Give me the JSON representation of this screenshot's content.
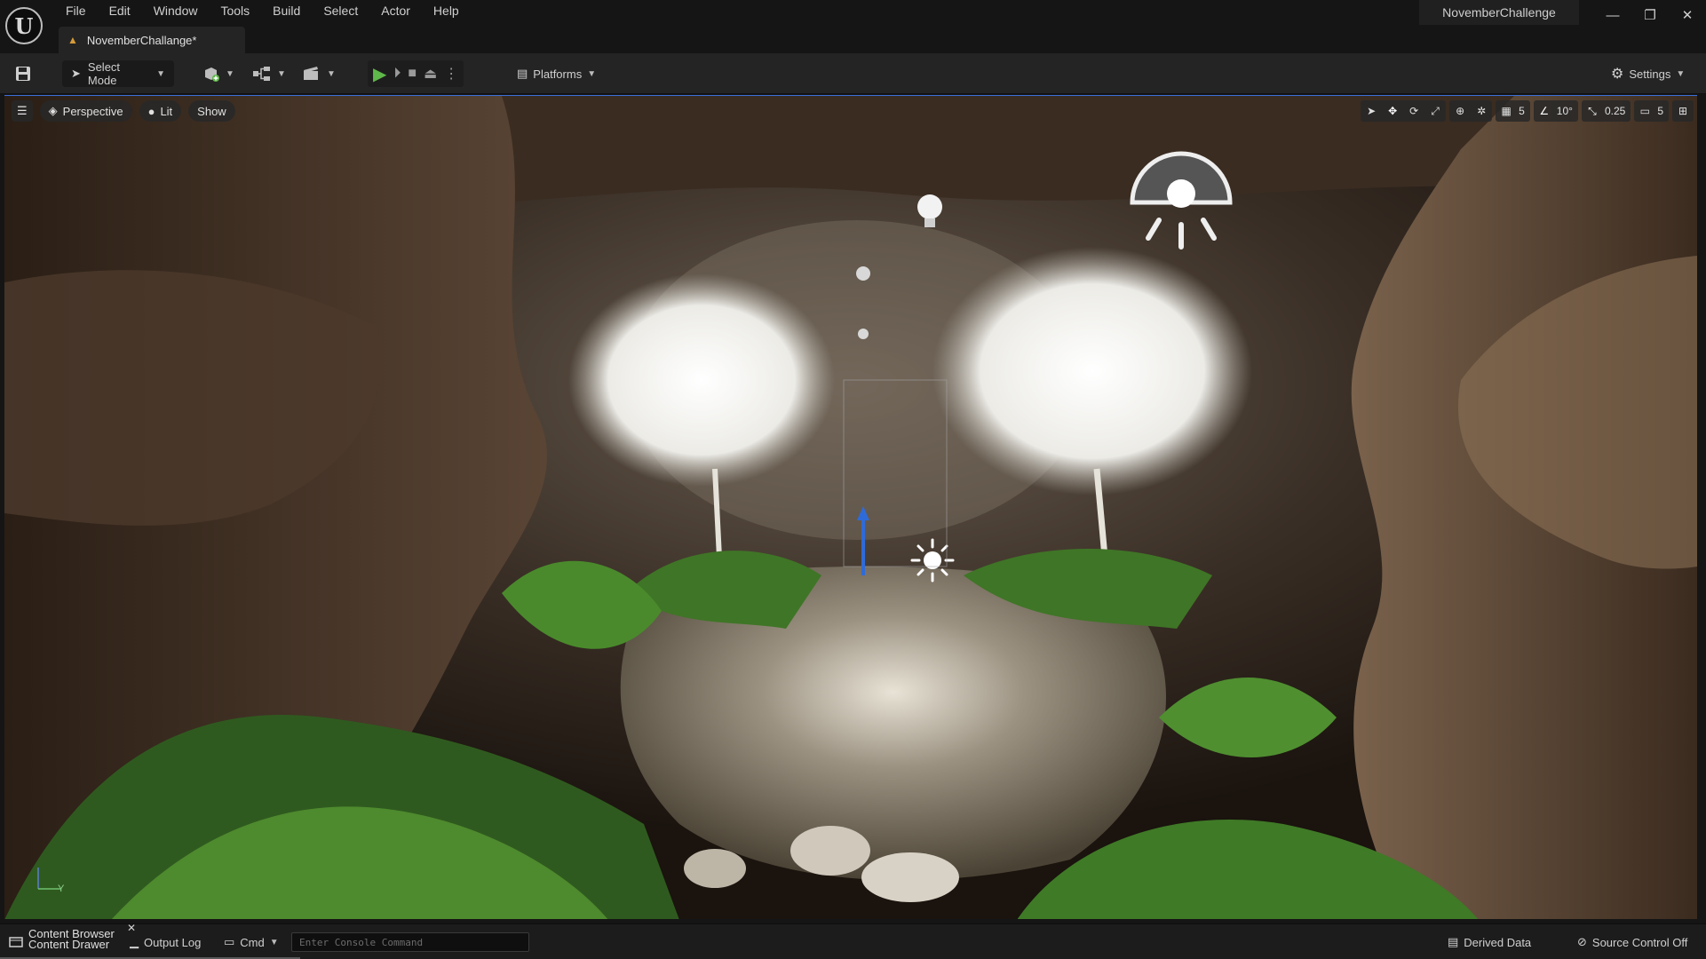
{
  "menu": [
    "File",
    "Edit",
    "Window",
    "Tools",
    "Build",
    "Select",
    "Actor",
    "Help"
  ],
  "document_tab": "NovemberChallange*",
  "project_name": "NovemberChallenge",
  "toolbar": {
    "select_mode": "Select Mode",
    "platforms": "Platforms",
    "settings": "Settings"
  },
  "viewport": {
    "perspective": "Perspective",
    "lit": "Lit",
    "show": "Show",
    "grid_snap": "5",
    "rotation_snap": "10°",
    "scale_snap": "0.25",
    "camera_speed": "5",
    "axis_label": "Y"
  },
  "statusbar": {
    "content_browser": "Content Browser",
    "content_drawer": "Content Drawer",
    "output_log": "Output Log",
    "cmd": "Cmd",
    "console_placeholder": "Enter Console Command",
    "derived_data": "Derived Data",
    "source_control": "Source Control Off"
  },
  "colors": {
    "accent": "#2f6bd8",
    "play_green": "#5fb84a",
    "warning": "#d59b3a"
  }
}
